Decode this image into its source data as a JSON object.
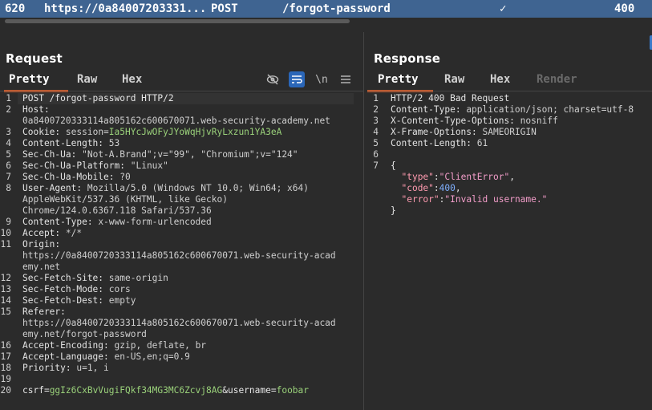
{
  "history": {
    "id": "620",
    "url": "https://0a84007203331...",
    "method": "POST",
    "path": "/forgot-password",
    "check": "✓",
    "status": "400"
  },
  "request": {
    "title": "Request",
    "tabs": [
      "Pretty",
      "Raw",
      "Hex"
    ],
    "tools": [
      "eye-off-icon",
      "wrap-icon",
      "newline-icon",
      "menu-icon"
    ],
    "newline_label": "\\n",
    "lines": [
      {
        "ln": "1",
        "text": "POST /forgot-password HTTP/2"
      },
      {
        "ln": "2",
        "name": "Host:",
        "value": ""
      },
      {
        "ln": "",
        "value": "0a8400720333114a805162c600670071.web-security-academy.net"
      },
      {
        "ln": "3",
        "name": "Cookie:",
        "value": "session=",
        "green": "Ia5HYcJwOFyJYoWqHjvRyLxzun1YA3eA"
      },
      {
        "ln": "4",
        "name": "Content-Length:",
        "value": "53"
      },
      {
        "ln": "5",
        "name": "Sec-Ch-Ua:",
        "value": "\"Not-A.Brand\";v=\"99\", \"Chromium\";v=\"124\""
      },
      {
        "ln": "6",
        "name": "Sec-Ch-Ua-Platform:",
        "value": "\"Linux\""
      },
      {
        "ln": "7",
        "name": "Sec-Ch-Ua-Mobile:",
        "value": "?0"
      },
      {
        "ln": "8",
        "name": "User-Agent:",
        "value": "Mozilla/5.0 (Windows NT 10.0; Win64; x64)"
      },
      {
        "ln": "",
        "value": "AppleWebKit/537.36 (KHTML, like Gecko)"
      },
      {
        "ln": "",
        "value": "Chrome/124.0.6367.118 Safari/537.36"
      },
      {
        "ln": "9",
        "name": "Content-Type:",
        "value": "x-www-form-urlencoded"
      },
      {
        "ln": "10",
        "name": "Accept:",
        "value": "*/*"
      },
      {
        "ln": "11",
        "name": "Origin:",
        "value": ""
      },
      {
        "ln": "",
        "value": "https://0a8400720333114a805162c600670071.web-security-acad"
      },
      {
        "ln": "",
        "value": "emy.net"
      },
      {
        "ln": "12",
        "name": "Sec-Fetch-Site:",
        "value": "same-origin"
      },
      {
        "ln": "13",
        "name": "Sec-Fetch-Mode:",
        "value": "cors"
      },
      {
        "ln": "14",
        "name": "Sec-Fetch-Dest:",
        "value": "empty"
      },
      {
        "ln": "15",
        "name": "Referer:",
        "value": ""
      },
      {
        "ln": "",
        "value": "https://0a8400720333114a805162c600670071.web-security-acad"
      },
      {
        "ln": "",
        "value": "emy.net/forgot-password"
      },
      {
        "ln": "16",
        "name": "Accept-Encoding:",
        "value": "gzip, deflate, br"
      },
      {
        "ln": "17",
        "name": "Accept-Language:",
        "value": "en-US,en;q=0.9"
      },
      {
        "ln": "18",
        "name": "Priority:",
        "value": "u=1, i"
      },
      {
        "ln": "19",
        "text": ""
      },
      {
        "ln": "20",
        "body": [
          "csrf=",
          "ggIz6CxBvVugiFQkf34MG3MC6Zcvj8AG",
          "&username=",
          "foobar"
        ]
      }
    ]
  },
  "response": {
    "title": "Response",
    "tabs": [
      "Pretty",
      "Raw",
      "Hex",
      "Render"
    ],
    "lines": [
      {
        "ln": "1",
        "text": "HTTP/2 400 Bad Request"
      },
      {
        "ln": "2",
        "name": "Content-Type:",
        "value": "application/json; charset=utf-8"
      },
      {
        "ln": "3",
        "name": "X-Content-Type-Options:",
        "value": "nosniff"
      },
      {
        "ln": "4",
        "name": "X-Frame-Options:",
        "value": "SAMEORIGIN"
      },
      {
        "ln": "5",
        "name": "Content-Length:",
        "value": "61"
      },
      {
        "ln": "6",
        "text": ""
      },
      {
        "ln": "7",
        "text": "{"
      },
      {
        "ln": "",
        "json": [
          "\"type\"",
          ":",
          "\"ClientError\"",
          ","
        ]
      },
      {
        "ln": "",
        "json": [
          "\"code\"",
          ":",
          "400",
          ","
        ]
      },
      {
        "ln": "",
        "json": [
          "\"error\"",
          ":",
          "\"Invalid username.\"",
          ""
        ]
      },
      {
        "ln": "",
        "text": "}"
      }
    ]
  }
}
